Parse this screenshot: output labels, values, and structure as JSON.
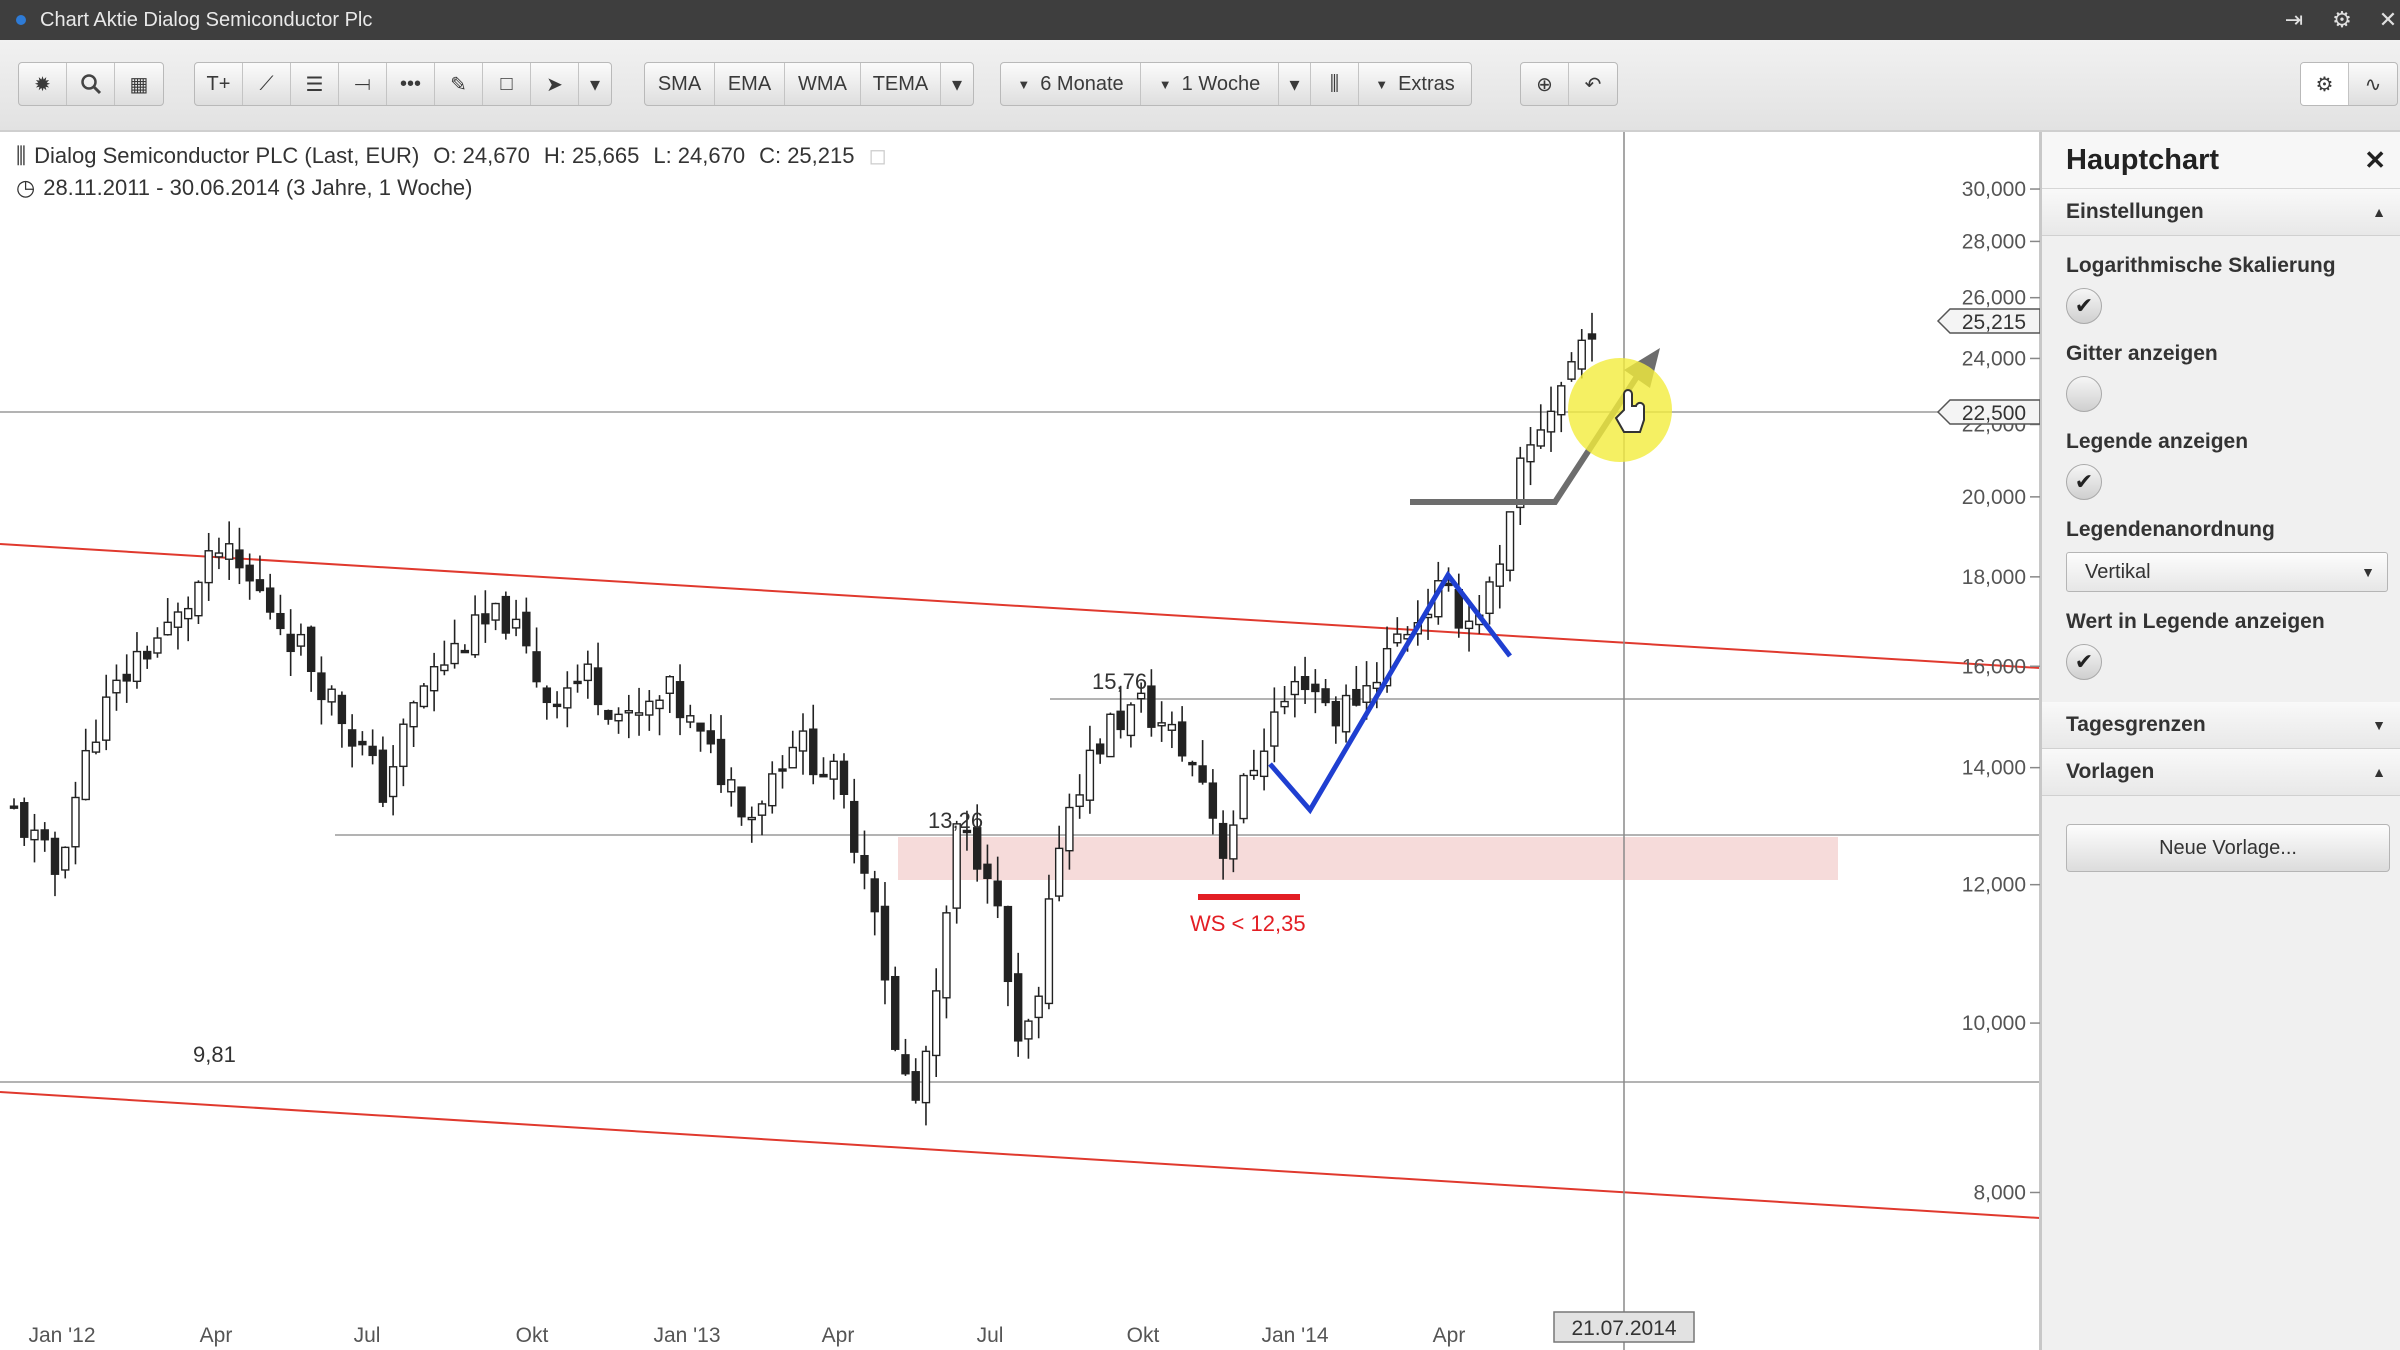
{
  "window": {
    "title": "Chart Aktie Dialog Semiconductor Plc",
    "controls": [
      "⇥",
      "⚙",
      "✕"
    ]
  },
  "toolbar": {
    "icons": [
      "gear-icon",
      "search-icon",
      "grid-icon",
      "text-tool-icon",
      "line-tool-icon",
      "fibonacci-icon",
      "hline-icon",
      "dotted-line-icon",
      "pencil-icon",
      "rectangle-icon",
      "arrow-icon"
    ],
    "indicators": [
      "SMA",
      "EMA",
      "WMA",
      "TEMA"
    ],
    "period": "6 Monate",
    "interval": "1 Woche",
    "extras": "Extras"
  },
  "legend": {
    "instrument": "Dialog Semiconductor PLC (Last, EUR)",
    "open": "O: 24,670",
    "high": "H: 25,665",
    "low": "L: 24,670",
    "close": "C: 25,215",
    "range": "28.11.2011 - 30.06.2014 (3 Jahre, 1 Woche)"
  },
  "chart_data": {
    "type": "candlestick",
    "scale": "log",
    "ylim": [
      7.3,
      31.5
    ],
    "yticks": [
      "30,000",
      "28,000",
      "26,000",
      "24,000",
      "22,000",
      "20,000",
      "18,000",
      "16,000",
      "14,000",
      "12,000",
      "10,000",
      "8,000"
    ],
    "ytick_values": [
      30,
      28,
      26,
      24,
      22,
      20,
      18,
      16,
      14,
      12,
      10,
      8
    ],
    "xticks": [
      "Jan '12",
      "Apr",
      "Jul",
      "Okt",
      "Jan '13",
      "Apr",
      "Jul",
      "Okt",
      "Jan '14",
      "Apr"
    ],
    "last_price": "25,215",
    "hline_price": "22,500",
    "crosshair_date": "21.07.2014",
    "annotations": [
      "15,76",
      "13,26",
      "9,81",
      "WS < 12,35"
    ],
    "colors": {
      "channel": "#e0392e",
      "pattern": "#1f3fd1",
      "highlight": "#f5d5d3",
      "signal": "#e31e24"
    }
  },
  "panel": {
    "title": "Hauptchart",
    "sections": {
      "settings": "Einstellungen",
      "daylimits": "Tagesgrenzen",
      "templates": "Vorlagen"
    },
    "options": {
      "log_scale": {
        "label": "Logarithmische Skalierung",
        "checked": true
      },
      "grid": {
        "label": "Gitter anzeigen",
        "checked": false
      },
      "legend": {
        "label": "Legende anzeigen",
        "checked": true
      },
      "legend_layout": {
        "label": "Legendenanordnung",
        "value": "Vertikal"
      },
      "legend_value": {
        "label": "Wert in Legende anzeigen",
        "checked": true
      }
    },
    "new_template": "Neue Vorlage..."
  }
}
